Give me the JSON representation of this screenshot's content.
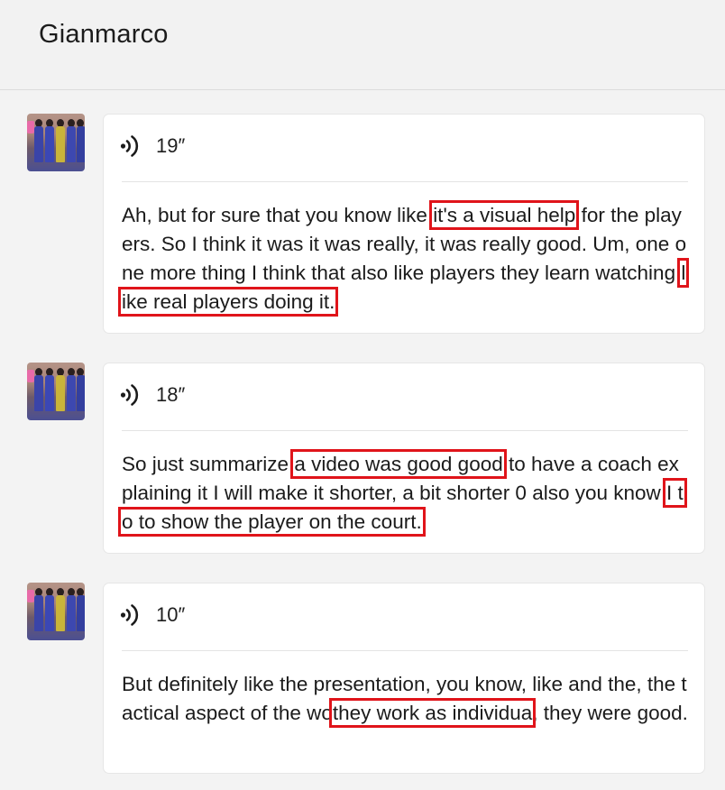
{
  "header": {
    "title": "Gianmarco"
  },
  "messages": [
    {
      "duration": "19″",
      "segments": [
        {
          "t": "Ah, but for sure that you know like "
        },
        {
          "t": "it's a visual help",
          "hl": true
        },
        {
          "t": " for the players. So I think it was it was really, it was really good. Um, one one more thing I think that also like players they learn watching "
        },
        {
          "t": "like real players doing it.",
          "hl": true
        }
      ]
    },
    {
      "duration": "18″",
      "segments": [
        {
          "t": "So just summarize "
        },
        {
          "t": "a video was good good",
          "hl": true
        },
        {
          "t": " to have a coach explaining it I will make it shorter, a bit shorter 0 also you know "
        },
        {
          "t": "I to to show the player on the court.",
          "hl": true
        }
      ]
    },
    {
      "duration": "10″",
      "segments": [
        {
          "t": "But definitely like the presentation, you know, like and the, the tactical aspect of the wo"
        },
        {
          "t": "they work as individua",
          "hl": true,
          "cover": true
        },
        {
          "t": ", they were good."
        }
      ]
    }
  ],
  "colors": {
    "highlight": "#e0141a",
    "background": "#f3f3f3",
    "bubble": "#ffffff"
  },
  "icons": {
    "voice": "sound-wave-icon",
    "avatar": "team-photo-avatar"
  }
}
